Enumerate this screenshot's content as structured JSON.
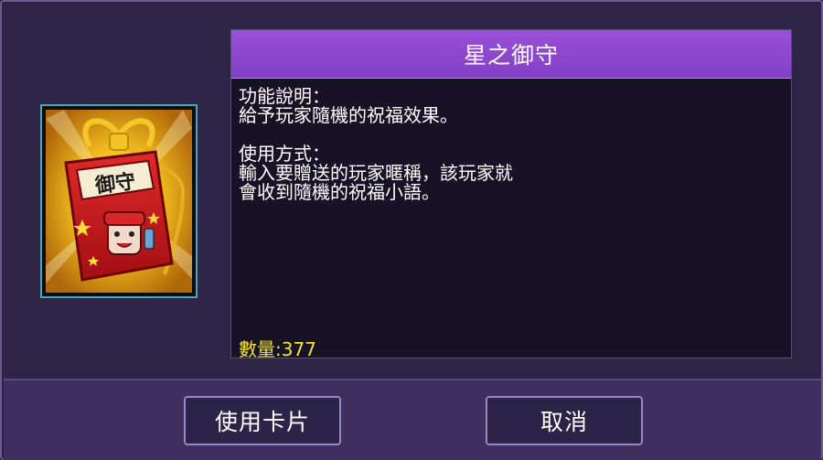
{
  "dialog": {
    "title": "星之御守",
    "description": {
      "function_heading": "功能說明：",
      "function_text": "給予玩家隨機的祝福效果。",
      "usage_heading": "使用方式：",
      "usage_line1": "輸入要贈送的玩家暱稱，該玩家就",
      "usage_line2": "會收到隨機的祝福小語。"
    },
    "quantity_label": "數量:",
    "quantity_value": "377",
    "item": {
      "icon": "omamori-charm-icon",
      "charm_text": "御守"
    }
  },
  "buttons": {
    "use_label": "使用卡片",
    "cancel_label": "取消"
  },
  "colors": {
    "title_bar": "#8f48d0",
    "panel_bg": "#181226",
    "quantity_text": "#f2e62a",
    "frame_border": "#49a9b6"
  }
}
